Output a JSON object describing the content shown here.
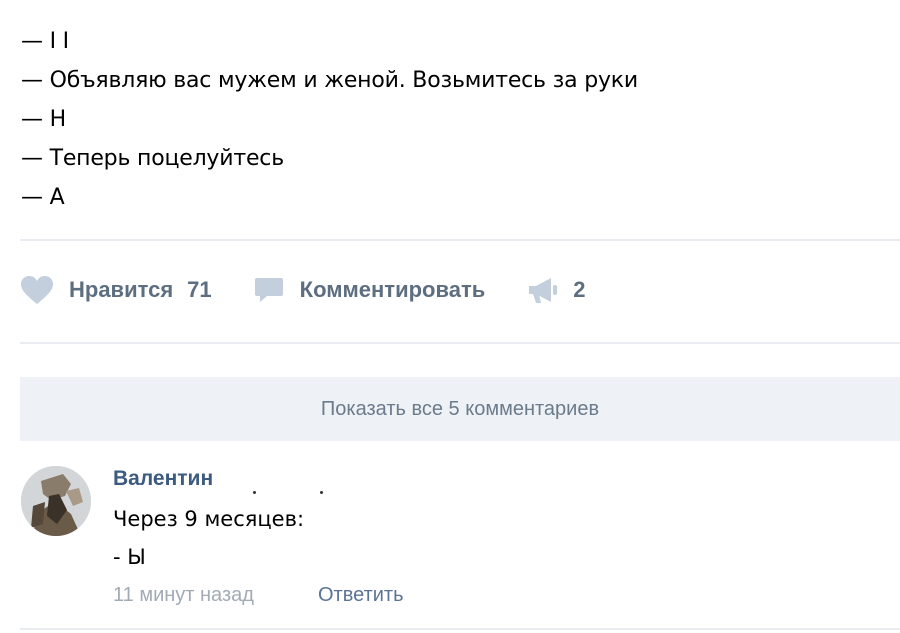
{
  "post": {
    "lines": [
      "— I I",
      "— Объявляю вас мужем и женой. Возьмитесь за руки",
      "— Н",
      "— Теперь поцелуйтесь",
      "— А"
    ]
  },
  "actions": {
    "like_label": "Нравится",
    "like_count": "71",
    "comment_label": "Комментировать",
    "share_count": "2",
    "icon_color": "#c3cfdc",
    "label_color": "#5d6e81"
  },
  "comments": {
    "show_all_label": "Показать все 5 комментариев",
    "items": [
      {
        "author": "Валентин",
        "text_lines": [
          "Через 9 месяцев:",
          "- Ы"
        ],
        "time": "11 минут назад",
        "reply_label": "Ответить"
      }
    ]
  }
}
